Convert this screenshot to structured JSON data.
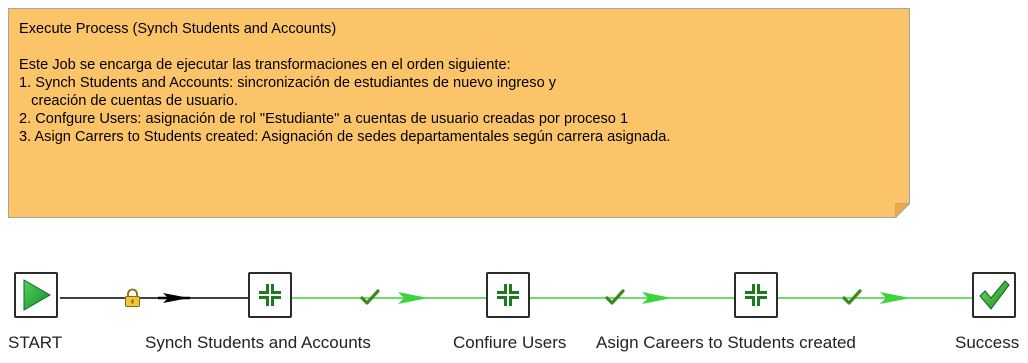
{
  "note": {
    "lines": [
      "Execute Process (Synch Students and Accounts)",
      "",
      "Este Job se encarga de ejecutar las transformaciones en el orden siguiente:",
      "1. Synch Students and Accounts: sincronización de estudiantes de nuevo ingreso y",
      "   creación de cuentas de usuario.",
      "2. Confgure Users: asignación de rol \"Estudiante\" a cuentas de usuario creadas por proceso 1",
      "3. Asign Carrers to Students created: Asignación de sedes departamentales según carrera asignada."
    ],
    "background_color": "#fcc468"
  },
  "entries": [
    {
      "label": "START",
      "icon": "play-icon"
    },
    {
      "label": "Synch Students and Accounts",
      "icon": "transformation-icon"
    },
    {
      "label": "Confiure Users",
      "icon": "transformation-icon"
    },
    {
      "label": "Asign Careers to Students created",
      "icon": "transformation-icon"
    },
    {
      "label": "Success",
      "icon": "checkmark-icon"
    }
  ],
  "hops": [
    {
      "from": "START",
      "to": "Synch Students and Accounts",
      "type": "unconditional",
      "color": "#000000",
      "status_icon": "lock-icon"
    },
    {
      "from": "Synch Students and Accounts",
      "to": "Confiure Users",
      "type": "success",
      "color": "#22c422",
      "status_icon": "check-icon"
    },
    {
      "from": "Confiure Users",
      "to": "Asign Careers to Students created",
      "type": "success",
      "color": "#22c422",
      "status_icon": "check-icon"
    },
    {
      "from": "Asign Careers to Students created",
      "to": "Success",
      "type": "success",
      "color": "#22c422",
      "status_icon": "check-icon"
    }
  ],
  "colors": {
    "note": "#fcc468",
    "success_hop": "#22c422",
    "unconditional_hop": "#000000",
    "start_icon": "#1fa83a",
    "transformation_icon": "#1e7a1e"
  }
}
